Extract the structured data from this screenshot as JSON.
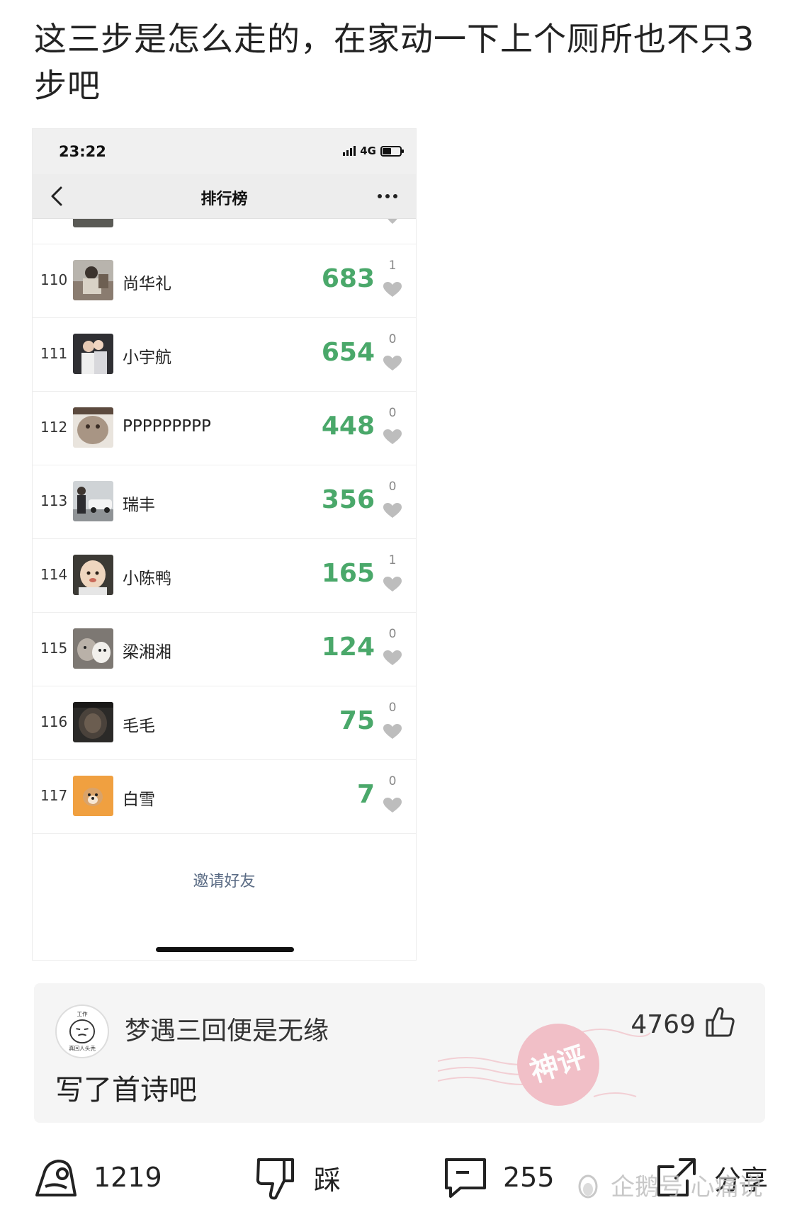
{
  "post": {
    "title": "这三步是怎么走的，在家动一下上个厕所也不只3步吧"
  },
  "phone": {
    "status": {
      "time": "23:22",
      "network": "4G",
      "battery_level": 0.5
    },
    "nav": {
      "title": "排行榜"
    },
    "leaderboard": [
      {
        "rank": "110",
        "name": "尚华礼",
        "steps": "683",
        "likes": "1",
        "avatar_icon": "avatar-photo-man-icon"
      },
      {
        "rank": "111",
        "name": "小宇航",
        "steps": "654",
        "likes": "0",
        "avatar_icon": "avatar-photo-couple-icon"
      },
      {
        "rank": "112",
        "name": "PPPPPPPPP",
        "steps": "448",
        "likes": "0",
        "avatar_icon": "avatar-photo-cat-icon"
      },
      {
        "rank": "113",
        "name": "瑞丰",
        "steps": "356",
        "likes": "0",
        "avatar_icon": "avatar-photo-car-icon"
      },
      {
        "rank": "114",
        "name": "小陈鸭",
        "steps": "165",
        "likes": "1",
        "avatar_icon": "avatar-photo-baby-icon"
      },
      {
        "rank": "115",
        "name": "梁湘湘",
        "steps": "124",
        "likes": "0",
        "avatar_icon": "avatar-photo-dogs-icon"
      },
      {
        "rank": "116",
        "name": "毛毛",
        "steps": "75",
        "likes": "0",
        "avatar_icon": "avatar-photo-dark-icon"
      },
      {
        "rank": "117",
        "name": "白雪",
        "steps": "7",
        "likes": "0",
        "avatar_icon": "avatar-photo-dog-icon"
      }
    ],
    "invite_label": "邀请好友"
  },
  "comment": {
    "avatar_caption_top": "工作",
    "avatar_caption_bottom": "真回人头秃",
    "username": "梦遇三回便是无缘",
    "like_count": "4769",
    "text": "写了首诗吧",
    "stamp_text": "神评"
  },
  "actions": {
    "praise_count": "1219",
    "dislike_label": "踩",
    "comment_count": "255",
    "share_label": "分享"
  },
  "watermark": "企鹅号 心痛说",
  "colors": {
    "steps_green": "#4aa86a",
    "invite_blue": "#5a6b84",
    "stamp_red": "#e9a3ad"
  }
}
